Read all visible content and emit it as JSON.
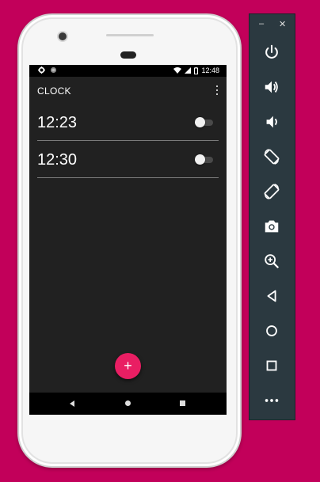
{
  "status_bar": {
    "time": "12:48"
  },
  "app_bar": {
    "title": "CLOCK"
  },
  "alarms": [
    {
      "time": "12:23",
      "enabled": false
    },
    {
      "time": "12:30",
      "enabled": false
    }
  ],
  "fab": {
    "label": "+"
  },
  "emulator_toolbar": {
    "minimize_label": "–",
    "close_label": "✕",
    "buttons": [
      "power",
      "volume-up",
      "volume-down",
      "rotate-left",
      "rotate-right",
      "screenshot",
      "zoom",
      "back",
      "home",
      "overview",
      "more"
    ]
  },
  "colors": {
    "background": "#c2005a",
    "accent": "#e91e63",
    "screen": "#212121",
    "toolbar": "#2b3940"
  }
}
